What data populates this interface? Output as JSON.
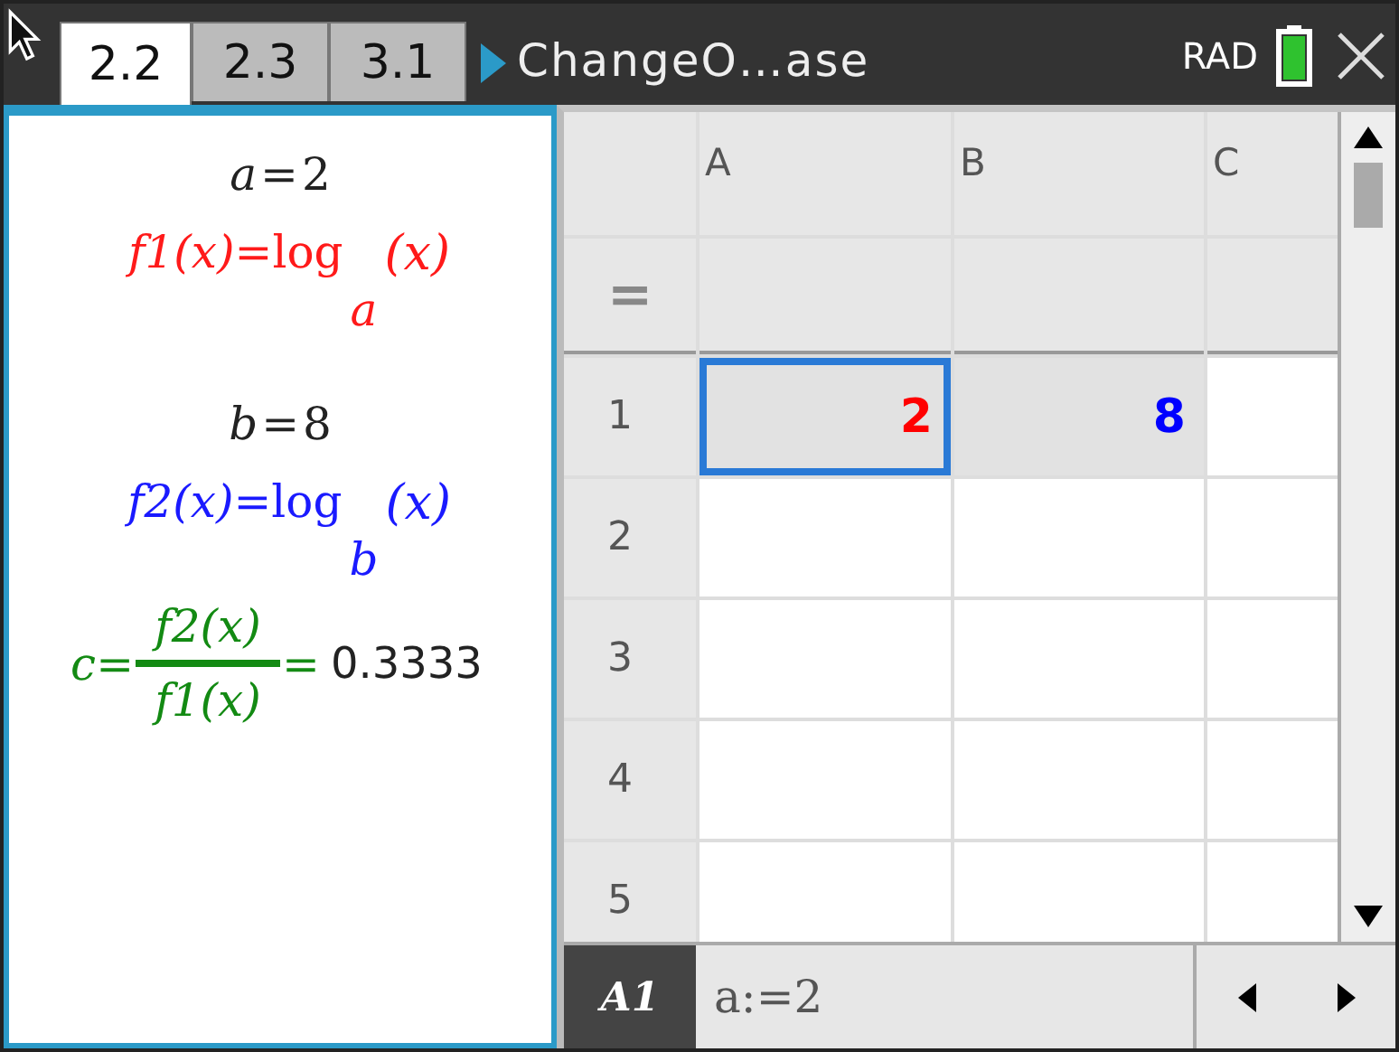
{
  "tabs": [
    {
      "label": "2.2",
      "selected": true
    },
    {
      "label": "2.3",
      "selected": false
    },
    {
      "label": "3.1",
      "selected": false
    }
  ],
  "document_title": "ChangeO…ase",
  "angle_mode": "RAD",
  "notes": [
    {
      "kind": "assign",
      "name": "a",
      "eq": "=",
      "value": "2",
      "color": "#222222"
    },
    {
      "kind": "log",
      "lhs": "f1(x)",
      "eq": "=",
      "func": "log",
      "base": "a",
      "arg": "(x)",
      "color": "#ff1a1a"
    },
    {
      "kind": "assign",
      "name": "b",
      "eq": "=",
      "value": "8",
      "color": "#222222"
    },
    {
      "kind": "log",
      "lhs": "f2(x)",
      "eq": "=",
      "func": "log",
      "base": "b",
      "arg": "(x)",
      "color": "#1a1aff"
    },
    {
      "kind": "fraction",
      "name": "c",
      "eq": "=",
      "numerator": "f2(x)",
      "denominator": "f1(x)",
      "eq2": "=",
      "result": "0.3333",
      "color": "#138a13"
    }
  ],
  "spreadsheet": {
    "columns": [
      "A",
      "B",
      "C"
    ],
    "formula_label": "=",
    "rows": [
      {
        "label": "1",
        "cells": [
          {
            "value": "2",
            "color": "#ff0000",
            "selected": true,
            "shaded": true
          },
          {
            "value": "8",
            "color": "#0000ff",
            "selected": false,
            "shaded": true
          },
          {
            "selected": false,
            "shaded": false
          }
        ]
      },
      {
        "label": "2",
        "cells": [
          {
            "selected": false,
            "shaded": false
          },
          {
            "selected": false,
            "shaded": false
          },
          {
            "selected": false,
            "shaded": false
          }
        ]
      },
      {
        "label": "3",
        "cells": [
          {
            "selected": false,
            "shaded": false
          },
          {
            "selected": false,
            "shaded": false
          },
          {
            "selected": false,
            "shaded": false
          }
        ]
      },
      {
        "label": "4",
        "cells": [
          {
            "selected": false,
            "shaded": false
          },
          {
            "selected": false,
            "shaded": false
          },
          {
            "selected": false,
            "shaded": false
          }
        ]
      },
      {
        "label": "5",
        "cells": [
          {
            "selected": false,
            "shaded": false
          },
          {
            "selected": false,
            "shaded": false
          },
          {
            "selected": false,
            "shaded": false
          }
        ]
      }
    ],
    "cell_reference": "A1",
    "entry": "a:=2"
  }
}
